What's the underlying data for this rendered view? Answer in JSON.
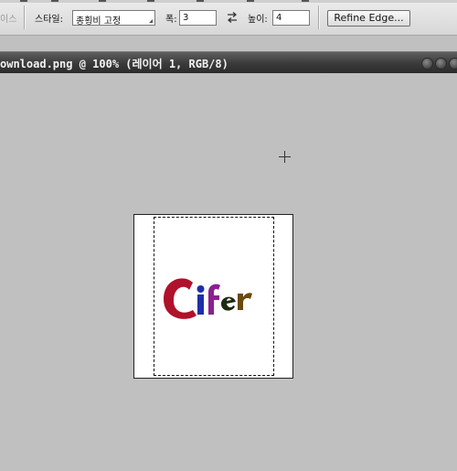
{
  "options_bar": {
    "antialias_label": "이스",
    "style_label": "스타일:",
    "style_value": "종횡비 고정",
    "width_label": "폭:",
    "width_value": "3",
    "height_label": "높이:",
    "height_value": "4",
    "refine_edge_label": "Refine Edge..."
  },
  "document": {
    "title": "ownload.png @ 100% (레이어 1, RGB/8)",
    "logo_text": "Cifer"
  },
  "colors": {
    "workspace": "#c0c0c0",
    "titlebar": "#3a3a3a",
    "logo_C": "#b0112b",
    "logo_i": "#1c2fa8",
    "logo_f": "#8a2090",
    "logo_e": "#1e2a12",
    "logo_r": "#6b4a10"
  },
  "icons": [
    "swap-icon",
    "crosshair-icon",
    "window-buttons"
  ]
}
